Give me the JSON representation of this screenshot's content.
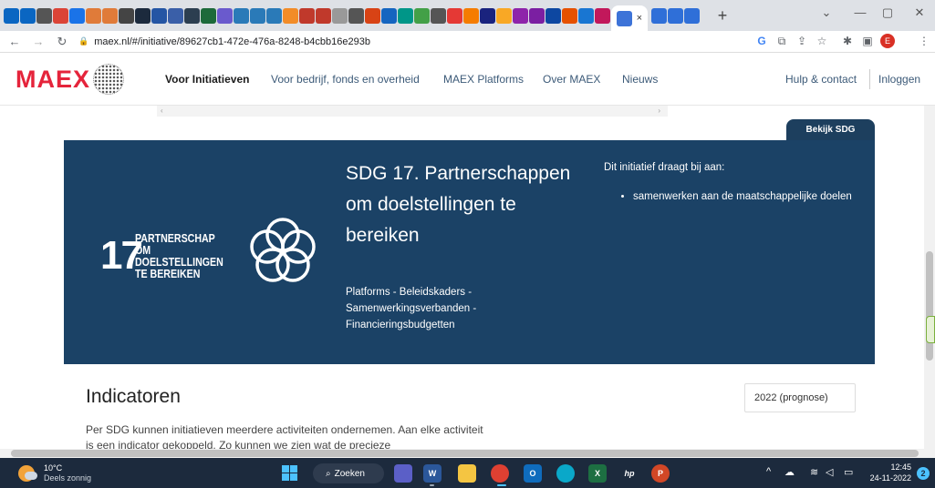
{
  "browser": {
    "tab_close": "×",
    "new_tab": "+",
    "url": "maex.nl/#/initiative/89627cb1-472e-476a-8248-b4cbb16e293b",
    "profile_initial": "E",
    "win_min": "—",
    "win_max": "▢",
    "win_close": "✕",
    "win_chevron": "⌄"
  },
  "site": {
    "logo": "MAEX",
    "nav": [
      "Voor Initiatieven",
      "Voor bedrijf, fonds en overheid",
      "MAEX Platforms",
      "Over MAEX",
      "Nieuws"
    ],
    "help": "Hulp & contact",
    "login": "Inloggen"
  },
  "sdg": {
    "tab_label": "Bekijk SDG",
    "icon_number": "17",
    "icon_label": "PARTNERSCHAP OM DOELSTELLINGEN TE BEREIKEN",
    "title": "SDG 17. Partnerschappen om doelstellingen te bereiken",
    "tags": "Platforms - Beleidskaders - Samenwerkingsverbanden - Financieringsbudgetten",
    "contrib_heading": "Dit initiatief draagt bij aan:",
    "contrib_items": [
      "samenwerken aan de maatschappelijke doelen"
    ],
    "color": "#1b4266"
  },
  "indicators": {
    "title": "Indicatoren",
    "year_select": "2022 (prognose)",
    "text": "Per SDG kunnen initiatieven meerdere activiteiten ondernemen. Aan elke activiteit is een indicator gekoppeld. Zo kunnen we zien wat de precieze"
  },
  "taskbar": {
    "temp": "10°C",
    "weather": "Deels zonnig",
    "search": "Zoeken",
    "time": "12:45",
    "date": "24-11-2022",
    "notifications": "2"
  }
}
